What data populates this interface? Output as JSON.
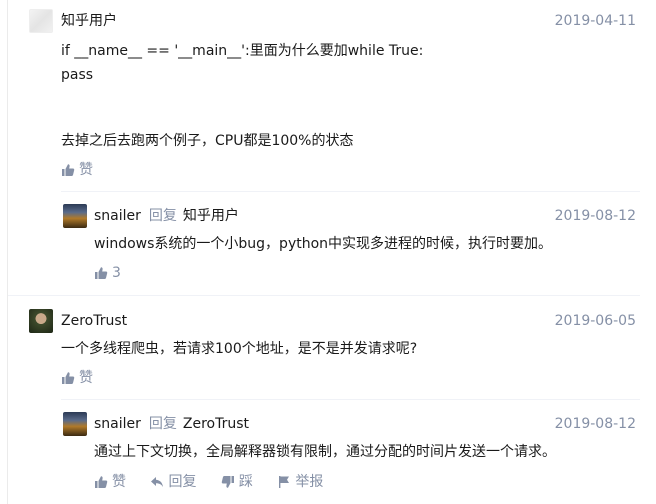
{
  "comments": [
    {
      "author": "知乎用户",
      "date": "2019-04-11",
      "lines": [
        "if __name__ == '__main__':里面为什么要加while True:",
        "pass",
        "",
        "去掉之后去跑两个例子，CPU都是100%的状态"
      ],
      "like_label": "赞",
      "replies": [
        {
          "author": "snailer",
          "reply_word": "回复",
          "reply_to": "知乎用户",
          "date": "2019-08-12",
          "text": "windows系统的一个小bug，python中实现多进程的时候，执行时要加。",
          "like_count": "3"
        }
      ]
    },
    {
      "author": "ZeroTrust",
      "date": "2019-06-05",
      "text": "一个多线程爬虫，若请求100个地址，是不是并发请求呢?",
      "like_label": "赞",
      "replies": [
        {
          "author": "snailer",
          "reply_word": "回复",
          "reply_to": "ZeroTrust",
          "date": "2019-08-12",
          "text": "通过上下文切换，全局解释器锁有限制，通过分配的时间片发送一个请求。",
          "actions": {
            "like": "赞",
            "reply": "回复",
            "dislike": "踩",
            "report": "举报"
          }
        }
      ]
    }
  ],
  "icons": {
    "thumb_up": "thumb-up-icon",
    "reply": "reply-arrow-icon",
    "thumb_down": "thumb-down-icon",
    "flag": "flag-icon"
  },
  "colors": {
    "text": "#1a1a1a",
    "meta": "#8590a6",
    "divider": "#f0f2f7"
  }
}
